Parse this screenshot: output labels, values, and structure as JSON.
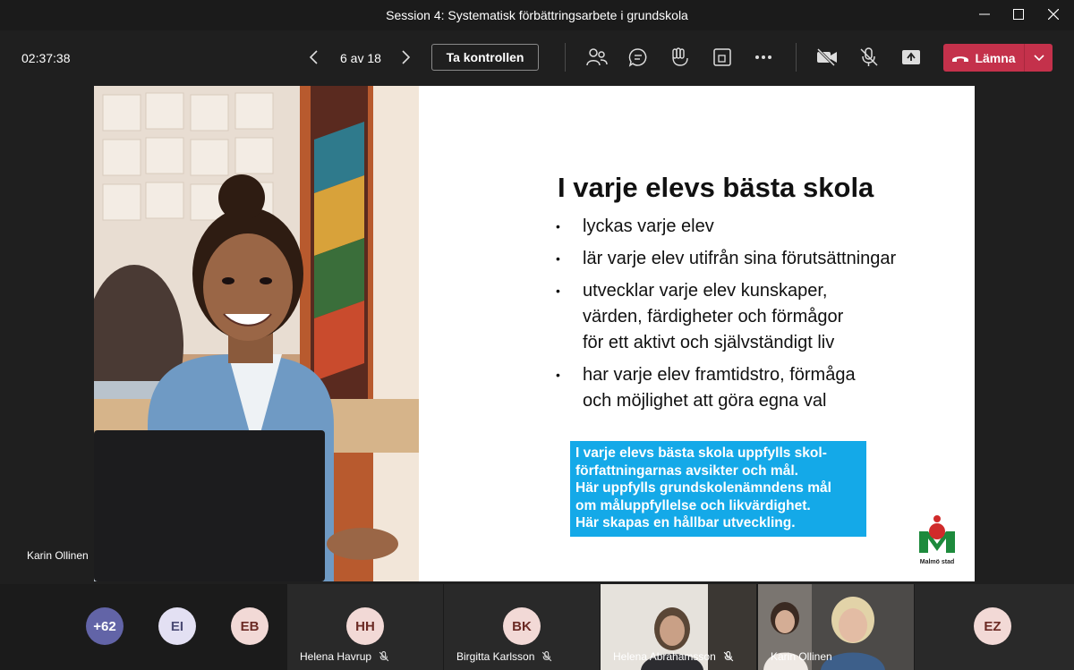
{
  "window": {
    "title": "Session 4: Systematisk förbättringsarbete i grundskola",
    "minimize_icon": "minimize-icon",
    "maximize_icon": "maximize-icon",
    "close_icon": "close-icon"
  },
  "toolbar": {
    "timer": "02:37:38",
    "slide_counter": "6 av 18",
    "take_control_label": "Ta kontrollen",
    "leave_label": "Lämna",
    "icons": [
      "participants-icon",
      "chat-icon",
      "raise-hand-icon",
      "rooms-icon",
      "more-icon",
      "camera-off-icon",
      "mic-off-icon",
      "share-icon"
    ]
  },
  "slide": {
    "title": "I varje elevs bästa skola",
    "bullets": [
      "lyckas varje elev",
      "lär varje elev utifrån sina förutsättningar",
      "utvecklar varje elev kunskaper, värden, färdigheter och förmågor för ett aktivt och självständigt liv",
      "har varje elev framtidstro, förmåga och möjlighet att göra egna val"
    ],
    "bullet_lines": [
      [
        "lyckas varje elev"
      ],
      [
        "lär varje elev utifrån sina förutsättningar"
      ],
      [
        "utvecklar varje elev kunskaper,",
        "värden, färdigheter och förmågor",
        "för ett aktivt och självständigt liv"
      ],
      [
        "har varje elev framtidstro, förmåga",
        "och möjlighet att göra egna val"
      ]
    ],
    "box_lines": [
      "I varje elevs bästa skola uppfylls skol-",
      "författningarnas avsikter och mål.",
      "Här uppfylls grundskolenämndens mål",
      "om måluppfyllelse och likvärdighet.",
      "Här skapas en hållbar utveckling."
    ],
    "logo_text": "Malmö stad",
    "box_color": "#14a9e8"
  },
  "presenter": {
    "name": "Karin Ollinen"
  },
  "participants": {
    "overflow_count": "+62",
    "avatars": [
      {
        "initials": "EI"
      },
      {
        "initials": "EB"
      }
    ],
    "tiles": [
      {
        "initials": "HH",
        "name": "Helena Havrup",
        "muted": true
      },
      {
        "initials": "BK",
        "name": "Birgitta Karlsson",
        "muted": true
      },
      {
        "name": "Helena Abrahamsson",
        "muted": true
      },
      {
        "name": "Karin Ollinen",
        "muted": false
      },
      {
        "initials": "EZ"
      }
    ]
  },
  "colors": {
    "leave": "#c4314b",
    "background": "#1f1f1f",
    "overflow_avatar": "#6264a7"
  }
}
